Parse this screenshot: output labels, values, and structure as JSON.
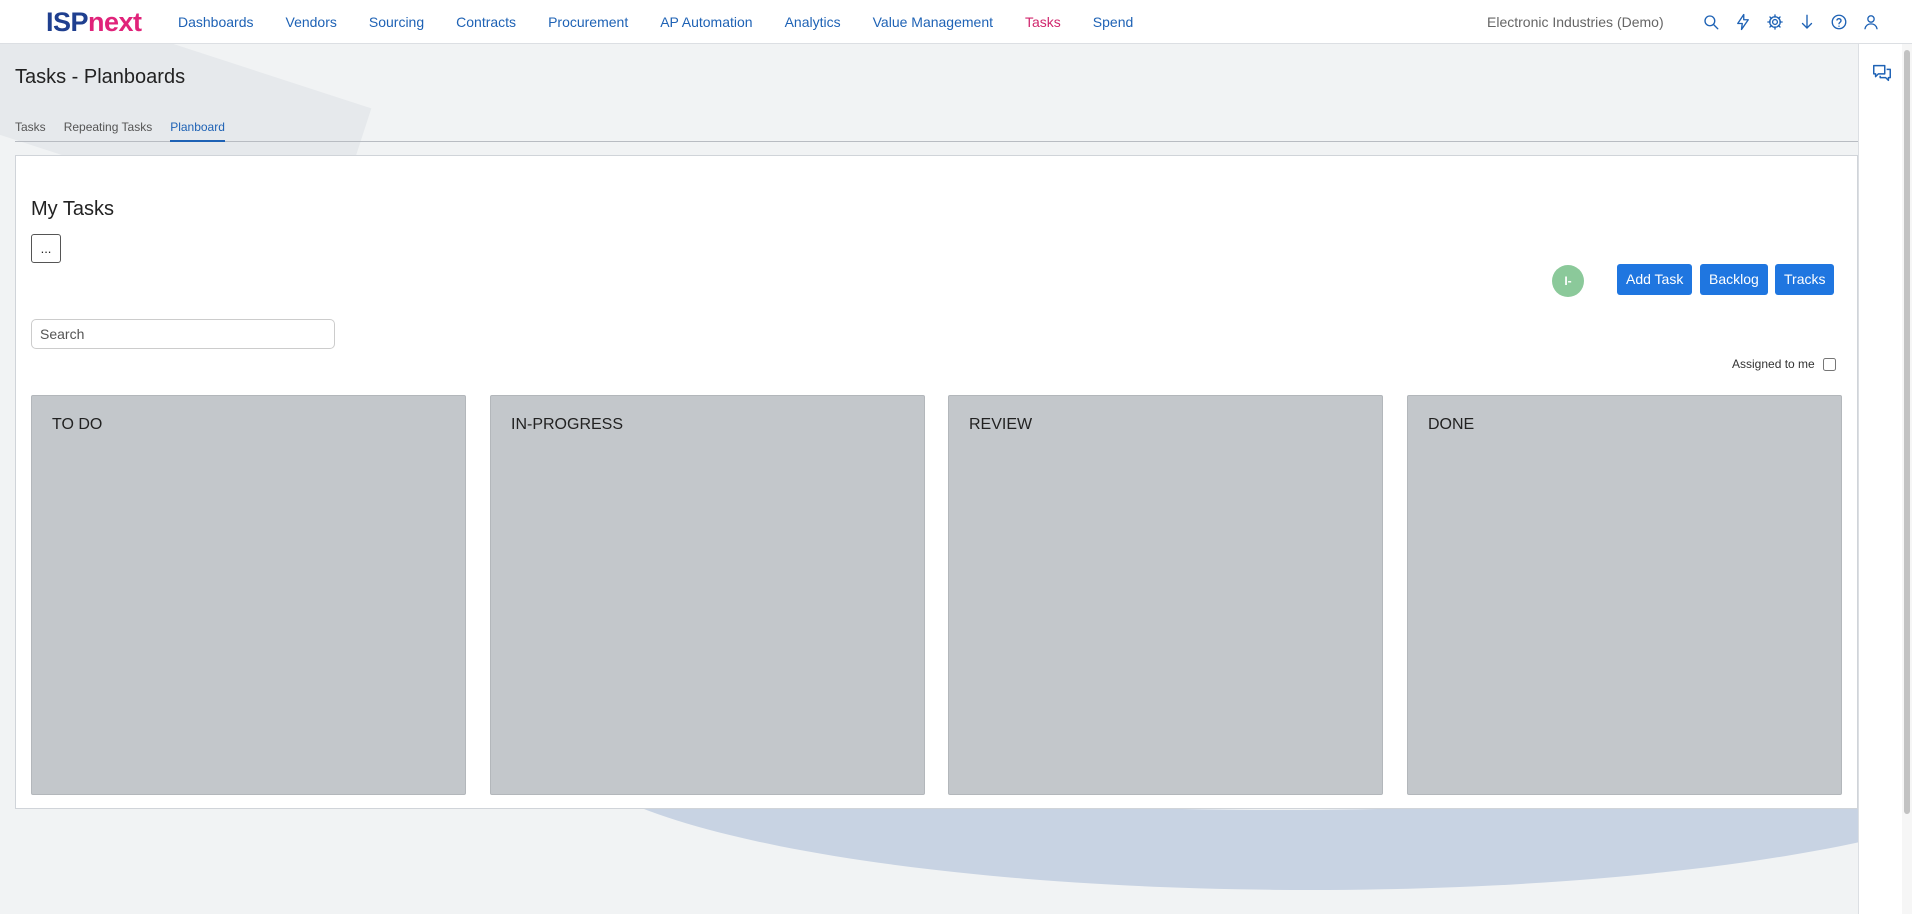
{
  "brand": {
    "part1": "ISP",
    "part2": "next"
  },
  "nav": {
    "items": [
      {
        "label": "Dashboards",
        "active": false
      },
      {
        "label": "Vendors",
        "active": false
      },
      {
        "label": "Sourcing",
        "active": false
      },
      {
        "label": "Contracts",
        "active": false
      },
      {
        "label": "Procurement",
        "active": false
      },
      {
        "label": "AP Automation",
        "active": false
      },
      {
        "label": "Analytics",
        "active": false
      },
      {
        "label": "Value Management",
        "active": false
      },
      {
        "label": "Tasks",
        "active": true
      },
      {
        "label": "Spend",
        "active": false
      }
    ],
    "organization": "Electronic Industries (Demo)",
    "icons": [
      "search-icon",
      "lightning-icon",
      "gear-icon",
      "download-icon",
      "help-icon",
      "user-icon"
    ]
  },
  "page": {
    "title": "Tasks - Planboards",
    "tabs": [
      {
        "label": "Tasks",
        "active": false
      },
      {
        "label": "Repeating Tasks",
        "active": false
      },
      {
        "label": "Planboard",
        "active": true
      }
    ]
  },
  "board": {
    "title": "My Tasks",
    "more_label": "...",
    "avatar_initials": "I-",
    "buttons": {
      "add_task": "Add Task",
      "backlog": "Backlog",
      "tracks": "Tracks"
    },
    "search_placeholder": "Search",
    "assigned_label": "Assigned to me",
    "assigned_checked": false,
    "lanes": [
      {
        "title": "TO DO"
      },
      {
        "title": "IN-PROGRESS"
      },
      {
        "title": "REVIEW"
      },
      {
        "title": "DONE"
      }
    ]
  },
  "right_rail": {
    "icons": [
      "chat-icon"
    ]
  },
  "colors": {
    "brand_dark": "#1f3f8f",
    "brand_accent": "#e0237a",
    "link": "#1e62b5",
    "active_nav": "#d0276d",
    "button": "#1f76e0",
    "lane": "#c3c7cb",
    "avatar": "#8bc99a"
  }
}
